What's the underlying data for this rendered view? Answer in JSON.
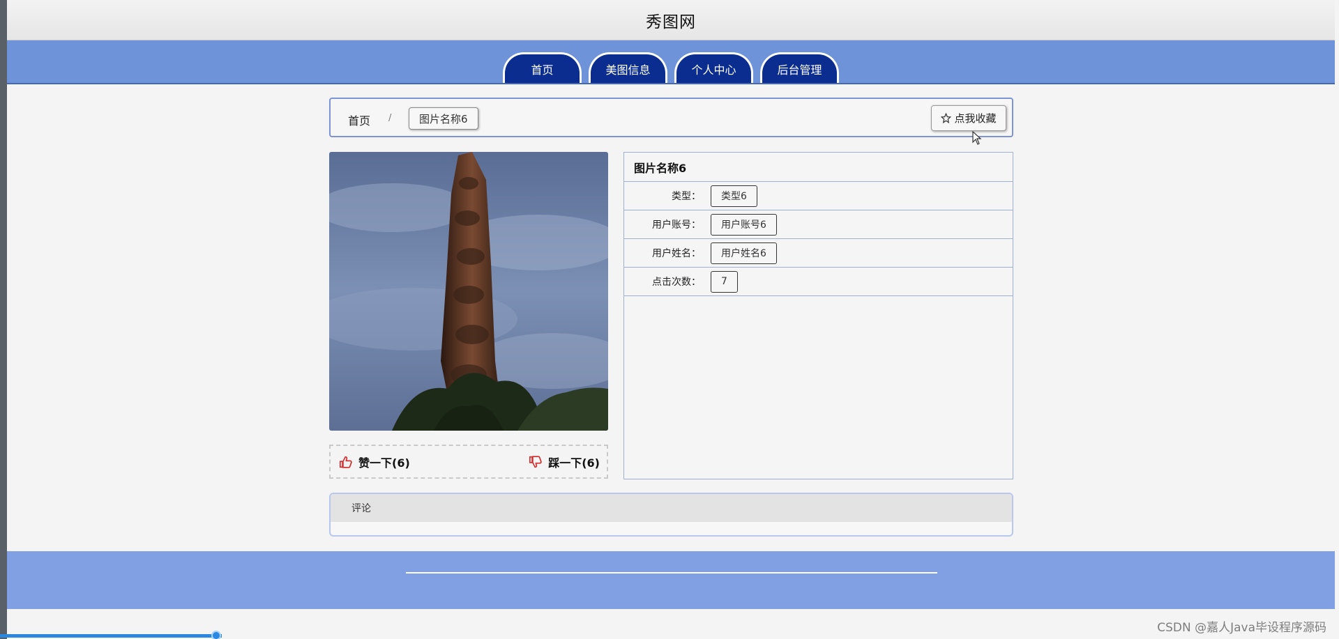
{
  "header": {
    "site_title": "秀图网"
  },
  "nav": {
    "tabs": [
      {
        "label": "首页"
      },
      {
        "label": "美图信息"
      },
      {
        "label": "个人中心"
      },
      {
        "label": "后台管理"
      }
    ]
  },
  "breadcrumb": {
    "home": "首页",
    "separator": "/",
    "current": "图片名称6",
    "favorite_label": "点我收藏"
  },
  "votes": {
    "like_label": "赞一下(6)",
    "dislike_label": "踩一下(6)"
  },
  "details": {
    "title": "图片名称6",
    "rows": [
      {
        "label": "类型：",
        "value": "类型6"
      },
      {
        "label": "用户账号：",
        "value": "用户账号6"
      },
      {
        "label": "用户姓名：",
        "value": "用户姓名6"
      },
      {
        "label": "点击次数：",
        "value": "7"
      }
    ]
  },
  "comments": {
    "title": "评论"
  },
  "watermark": "CSDN @嘉人Java毕设程序源码",
  "colors": {
    "nav_bar": "#6f93d9",
    "nav_tab": "#0b2d8f",
    "footer": "#80a0e3",
    "accent_red": "#d42a2a"
  }
}
